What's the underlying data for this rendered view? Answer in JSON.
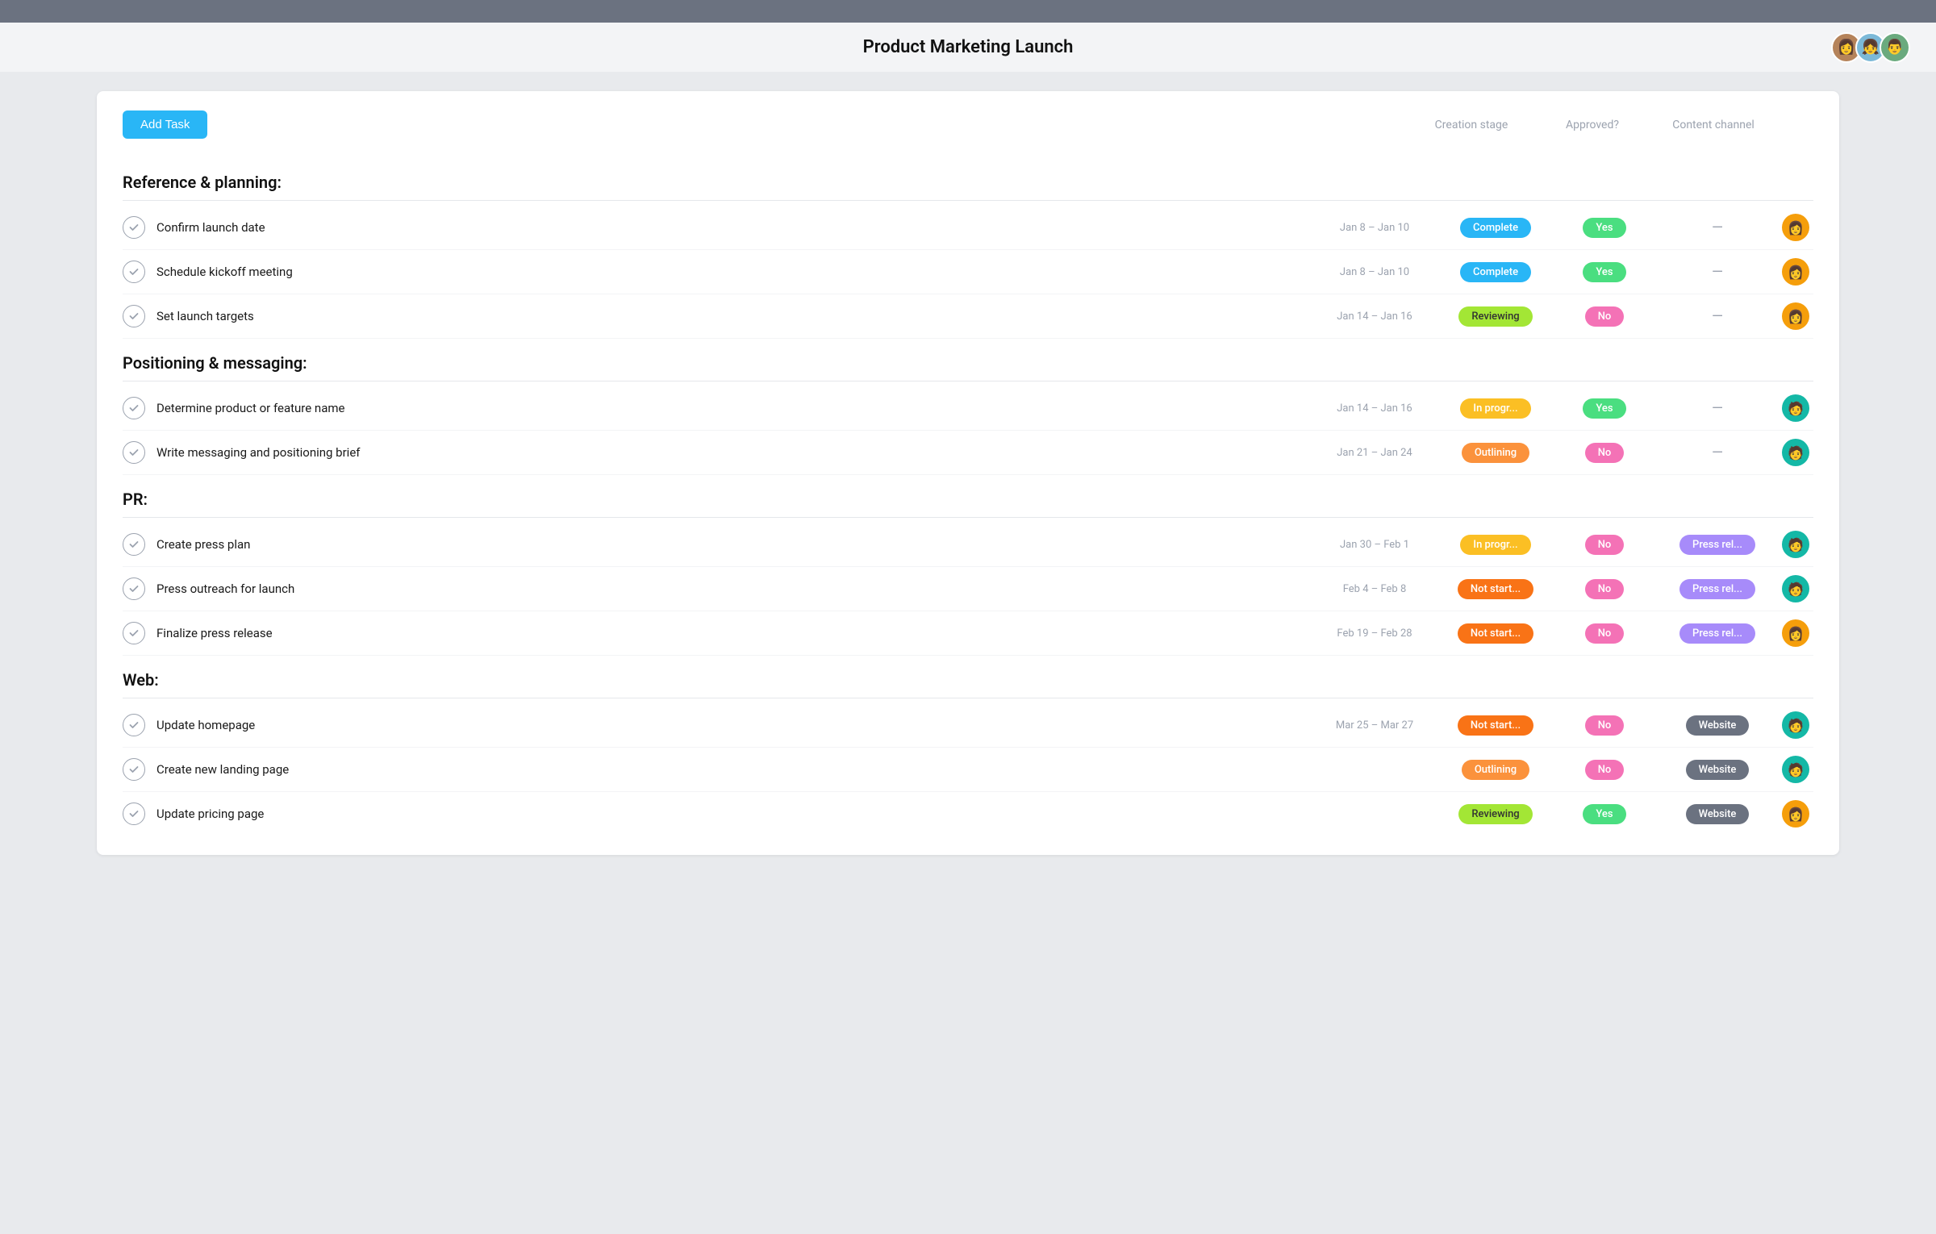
{
  "topbar": {},
  "header": {
    "title": "Product Marketing Launch",
    "avatars": [
      {
        "id": "avatar-1",
        "emoji": "👩",
        "color": "#b5835a"
      },
      {
        "id": "avatar-2",
        "emoji": "👧",
        "color": "#7cb9d8"
      },
      {
        "id": "avatar-3",
        "emoji": "👨",
        "color": "#6aaa7e"
      }
    ]
  },
  "toolbar": {
    "add_task_label": "Add Task",
    "col_creation": "Creation stage",
    "col_approved": "Approved?",
    "col_channel": "Content channel"
  },
  "sections": [
    {
      "id": "reference-planning",
      "title": "Reference & planning:",
      "tasks": [
        {
          "id": "task-1",
          "name": "Confirm launch date",
          "dates": "Jan 8 – Jan 10",
          "status": "Complete",
          "status_class": "badge-complete",
          "approved": "Yes",
          "approved_class": "badge-yes",
          "channel": "—",
          "channel_class": "",
          "avatar_emoji": "👩",
          "avatar_color": "#f59e0b"
        },
        {
          "id": "task-2",
          "name": "Schedule kickoff meeting",
          "dates": "Jan 8 – Jan 10",
          "status": "Complete",
          "status_class": "badge-complete",
          "approved": "Yes",
          "approved_class": "badge-yes",
          "channel": "—",
          "channel_class": "",
          "avatar_emoji": "👩",
          "avatar_color": "#f59e0b"
        },
        {
          "id": "task-3",
          "name": "Set launch targets",
          "dates": "Jan 14 – Jan 16",
          "status": "Reviewing",
          "status_class": "badge-reviewing",
          "approved": "No",
          "approved_class": "badge-no",
          "channel": "—",
          "channel_class": "",
          "avatar_emoji": "👩",
          "avatar_color": "#f59e0b"
        }
      ]
    },
    {
      "id": "positioning-messaging",
      "title": "Positioning & messaging:",
      "tasks": [
        {
          "id": "task-4",
          "name": "Determine product or feature name",
          "dates": "Jan 14 – Jan 16",
          "status": "In progr...",
          "status_class": "badge-inprogress",
          "approved": "Yes",
          "approved_class": "badge-yes",
          "channel": "—",
          "channel_class": "",
          "avatar_emoji": "🧑",
          "avatar_color": "#14b8a6"
        },
        {
          "id": "task-5",
          "name": "Write messaging and positioning brief",
          "dates": "Jan 21 – Jan 24",
          "status": "Outlining",
          "status_class": "badge-outlining",
          "approved": "No",
          "approved_class": "badge-no",
          "channel": "—",
          "channel_class": "",
          "avatar_emoji": "🧑",
          "avatar_color": "#14b8a6"
        }
      ]
    },
    {
      "id": "pr",
      "title": "PR:",
      "tasks": [
        {
          "id": "task-6",
          "name": "Create press plan",
          "dates": "Jan 30 – Feb 1",
          "status": "In progr...",
          "status_class": "badge-inprogress",
          "approved": "No",
          "approved_class": "badge-no",
          "channel": "Press rel...",
          "channel_class": "badge-pressrel",
          "avatar_emoji": "🧑",
          "avatar_color": "#14b8a6"
        },
        {
          "id": "task-7",
          "name": "Press outreach for launch",
          "dates": "Feb 4 – Feb 8",
          "status": "Not start...",
          "status_class": "badge-notstart",
          "approved": "No",
          "approved_class": "badge-no",
          "channel": "Press rel...",
          "channel_class": "badge-pressrel",
          "avatar_emoji": "🧑",
          "avatar_color": "#14b8a6"
        },
        {
          "id": "task-8",
          "name": "Finalize press release",
          "dates": "Feb 19 – Feb 28",
          "status": "Not start...",
          "status_class": "badge-notstart",
          "approved": "No",
          "approved_class": "badge-no",
          "channel": "Press rel...",
          "channel_class": "badge-pressrel",
          "avatar_emoji": "👩",
          "avatar_color": "#f59e0b"
        }
      ]
    },
    {
      "id": "web",
      "title": "Web:",
      "tasks": [
        {
          "id": "task-9",
          "name": "Update homepage",
          "dates": "Mar 25 – Mar 27",
          "status": "Not start...",
          "status_class": "badge-notstart",
          "approved": "No",
          "approved_class": "badge-no",
          "channel": "Website",
          "channel_class": "badge-website",
          "avatar_emoji": "🧑",
          "avatar_color": "#14b8a6"
        },
        {
          "id": "task-10",
          "name": "Create new landing page",
          "dates": "",
          "status": "Outlining",
          "status_class": "badge-outlining",
          "approved": "No",
          "approved_class": "badge-no",
          "channel": "Website",
          "channel_class": "badge-website",
          "avatar_emoji": "🧑",
          "avatar_color": "#14b8a6"
        },
        {
          "id": "task-11",
          "name": "Update pricing page",
          "dates": "",
          "status": "Reviewing",
          "status_class": "badge-reviewing",
          "approved": "Yes",
          "approved_class": "badge-yes",
          "channel": "Website",
          "channel_class": "badge-website",
          "avatar_emoji": "👩",
          "avatar_color": "#f59e0b"
        }
      ]
    }
  ]
}
